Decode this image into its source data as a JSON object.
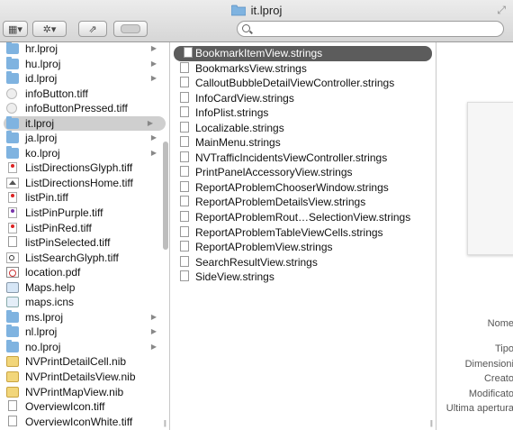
{
  "window": {
    "title": "it.lproj"
  },
  "toolbar": {
    "view_icon": "column-view-icon",
    "action_icon": "gear-icon",
    "share_icon": "share-icon",
    "toggle_icon": "toggle-icon",
    "search_placeholder": ""
  },
  "column1": {
    "items": [
      {
        "label": "hr.lproj",
        "icon": "folder",
        "arrow": true
      },
      {
        "label": "hu.lproj",
        "icon": "folder",
        "arrow": true
      },
      {
        "label": "id.lproj",
        "icon": "folder",
        "arrow": true
      },
      {
        "label": "infoButton.tiff",
        "icon": "gray-tiff",
        "arrow": false
      },
      {
        "label": "infoButtonPressed.tiff",
        "icon": "gray-tiff",
        "arrow": false
      },
      {
        "label": "it.lproj",
        "icon": "folder",
        "arrow": true,
        "selected": true
      },
      {
        "label": "ja.lproj",
        "icon": "folder",
        "arrow": true
      },
      {
        "label": "ko.lproj",
        "icon": "folder",
        "arrow": true
      },
      {
        "label": "ListDirectionsGlyph.tiff",
        "icon": "img-red",
        "arrow": false
      },
      {
        "label": "ListDirectionsHome.tiff",
        "icon": "house",
        "arrow": false
      },
      {
        "label": "listPin.tiff",
        "icon": "img-red",
        "arrow": false
      },
      {
        "label": "ListPinPurple.tiff",
        "icon": "img-purple",
        "arrow": false
      },
      {
        "label": "ListPinRed.tiff",
        "icon": "img-red",
        "arrow": false
      },
      {
        "label": "listPinSelected.tiff",
        "icon": "doc",
        "arrow": false
      },
      {
        "label": "ListSearchGlyph.tiff",
        "icon": "search-tiff",
        "arrow": false
      },
      {
        "label": "location.pdf",
        "icon": "pdf",
        "arrow": false
      },
      {
        "label": "Maps.help",
        "icon": "help",
        "arrow": false
      },
      {
        "label": "maps.icns",
        "icon": "icns",
        "arrow": false
      },
      {
        "label": "ms.lproj",
        "icon": "folder",
        "arrow": true
      },
      {
        "label": "nl.lproj",
        "icon": "folder",
        "arrow": true
      },
      {
        "label": "no.lproj",
        "icon": "folder",
        "arrow": true
      },
      {
        "label": "NVPrintDetailCell.nib",
        "icon": "nib",
        "arrow": false
      },
      {
        "label": "NVPrintDetailsView.nib",
        "icon": "nib",
        "arrow": false
      },
      {
        "label": "NVPrintMapView.nib",
        "icon": "nib",
        "arrow": false
      },
      {
        "label": "OverviewIcon.tiff",
        "icon": "doc",
        "arrow": false
      },
      {
        "label": "OverviewIconWhite.tiff",
        "icon": "doc",
        "arrow": false
      }
    ]
  },
  "column2": {
    "items": [
      {
        "label": "BookmarkItemView.strings",
        "selected": true
      },
      {
        "label": "BookmarksView.strings"
      },
      {
        "label": "CalloutBubbleDetailViewController.strings"
      },
      {
        "label": "InfoCardView.strings"
      },
      {
        "label": "InfoPlist.strings"
      },
      {
        "label": "Localizable.strings"
      },
      {
        "label": "MainMenu.strings"
      },
      {
        "label": "NVTrafficIncidentsViewController.strings"
      },
      {
        "label": "PrintPanelAccessoryView.strings"
      },
      {
        "label": "ReportAProblemChooserWindow.strings"
      },
      {
        "label": "ReportAProblemDetailsView.strings"
      },
      {
        "label": "ReportAProblemRout…SelectionView.strings"
      },
      {
        "label": "ReportAProblemTableViewCells.strings"
      },
      {
        "label": "ReportAProblemView.strings"
      },
      {
        "label": "SearchResultView.strings"
      },
      {
        "label": "SideView.strings"
      }
    ]
  },
  "preview": {
    "labels": [
      "Nome",
      "Tipo",
      "Dimensioni",
      "Creato",
      "Modificato",
      "Ultima apertura"
    ]
  }
}
